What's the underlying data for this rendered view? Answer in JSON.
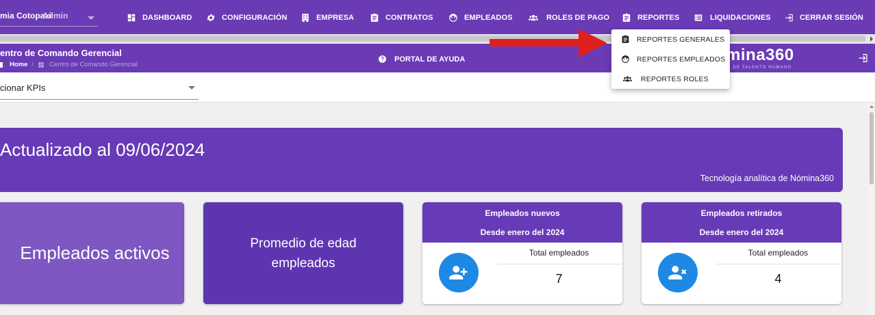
{
  "topbar": {
    "company": "mia Cotopaxi",
    "user": "Admin",
    "nav": [
      {
        "label": "DASHBOARD",
        "icon": "dashboard-icon"
      },
      {
        "label": "CONFIGURACIÓN",
        "icon": "gear-icon"
      },
      {
        "label": "EMPRESA",
        "icon": "building-icon"
      },
      {
        "label": "CONTRATOS",
        "icon": "clipboard-icon"
      },
      {
        "label": "EMPLEADOS",
        "icon": "face-icon"
      },
      {
        "label": "ROLES DE PAGO",
        "icon": "group-icon"
      },
      {
        "label": "REPORTES",
        "icon": "clipboard-icon"
      },
      {
        "label": "LIQUIDACIONES",
        "icon": "list-icon"
      },
      {
        "label": "CERRAR SESIÓN",
        "icon": "logout-icon"
      }
    ]
  },
  "subheader": {
    "title": "entro de Comando Gerencial",
    "breadcrumb_home": "Home",
    "breadcrumb_current": "Centro de Comando Gerencial",
    "help": "PORTAL DE AYUDA",
    "brand_name": "ómina360",
    "brand_tagline": "WARE DE TALENTO HUMANO"
  },
  "kpi": {
    "select_value": "cionar KPIs"
  },
  "banner": {
    "updated": "Actualizado al 09/06/2024",
    "tech": "Tecnología analítica de Nómina360"
  },
  "cards": {
    "activos": "Empleados activos",
    "edad_line1": "Promedio de edad",
    "edad_line2": "empleados",
    "nuevos": {
      "title": "Empleados nuevos",
      "subtitle": "Desde enero del 2024",
      "label": "Total empleados",
      "value": "7"
    },
    "retirados": {
      "title": "Empleados retirados",
      "subtitle": "Desde enero del 2024",
      "label": "Total empleados",
      "value": "4"
    }
  },
  "dropdown": {
    "items": [
      {
        "label": "REPORTES GENERALES",
        "icon": "clipboard-icon"
      },
      {
        "label": "REPORTES EMPLEADOS",
        "icon": "face-icon"
      },
      {
        "label": "REPORTES ROLES",
        "icon": "group-icon"
      }
    ]
  },
  "colors": {
    "primary": "#6a3bb5",
    "banner": "#673ab7",
    "card_light": "#7e57c2",
    "card_dark": "#5e35b1",
    "icon_circle": "#1e88e5",
    "arrow": "#e02020"
  }
}
